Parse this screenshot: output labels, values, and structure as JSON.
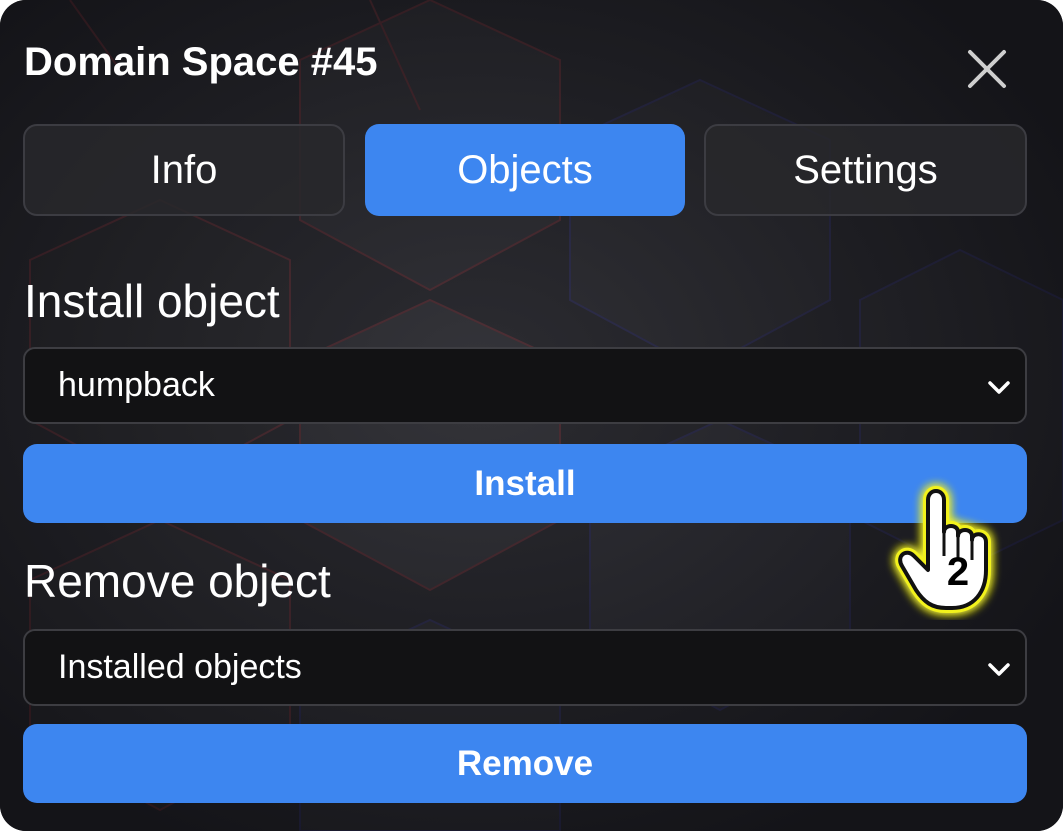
{
  "dialog": {
    "title": "Domain Space #45",
    "close_icon": "close-icon"
  },
  "tabs": [
    {
      "label": "Info",
      "active": false
    },
    {
      "label": "Objects",
      "active": true
    },
    {
      "label": "Settings",
      "active": false
    }
  ],
  "install": {
    "section_label": "Install object",
    "selected_value": "humpback",
    "button_label": "Install"
  },
  "remove": {
    "section_label": "Remove object",
    "selected_value": "Installed objects",
    "button_label": "Remove"
  },
  "annotation": {
    "cursor_icon": "hand-pointer-icon",
    "step_number": "2",
    "highlight_color": "#f2f21a"
  },
  "colors": {
    "accent": "#3d86f0",
    "panel_background": "#1b1b1f",
    "select_background": "#121214",
    "text": "#ffffff"
  }
}
